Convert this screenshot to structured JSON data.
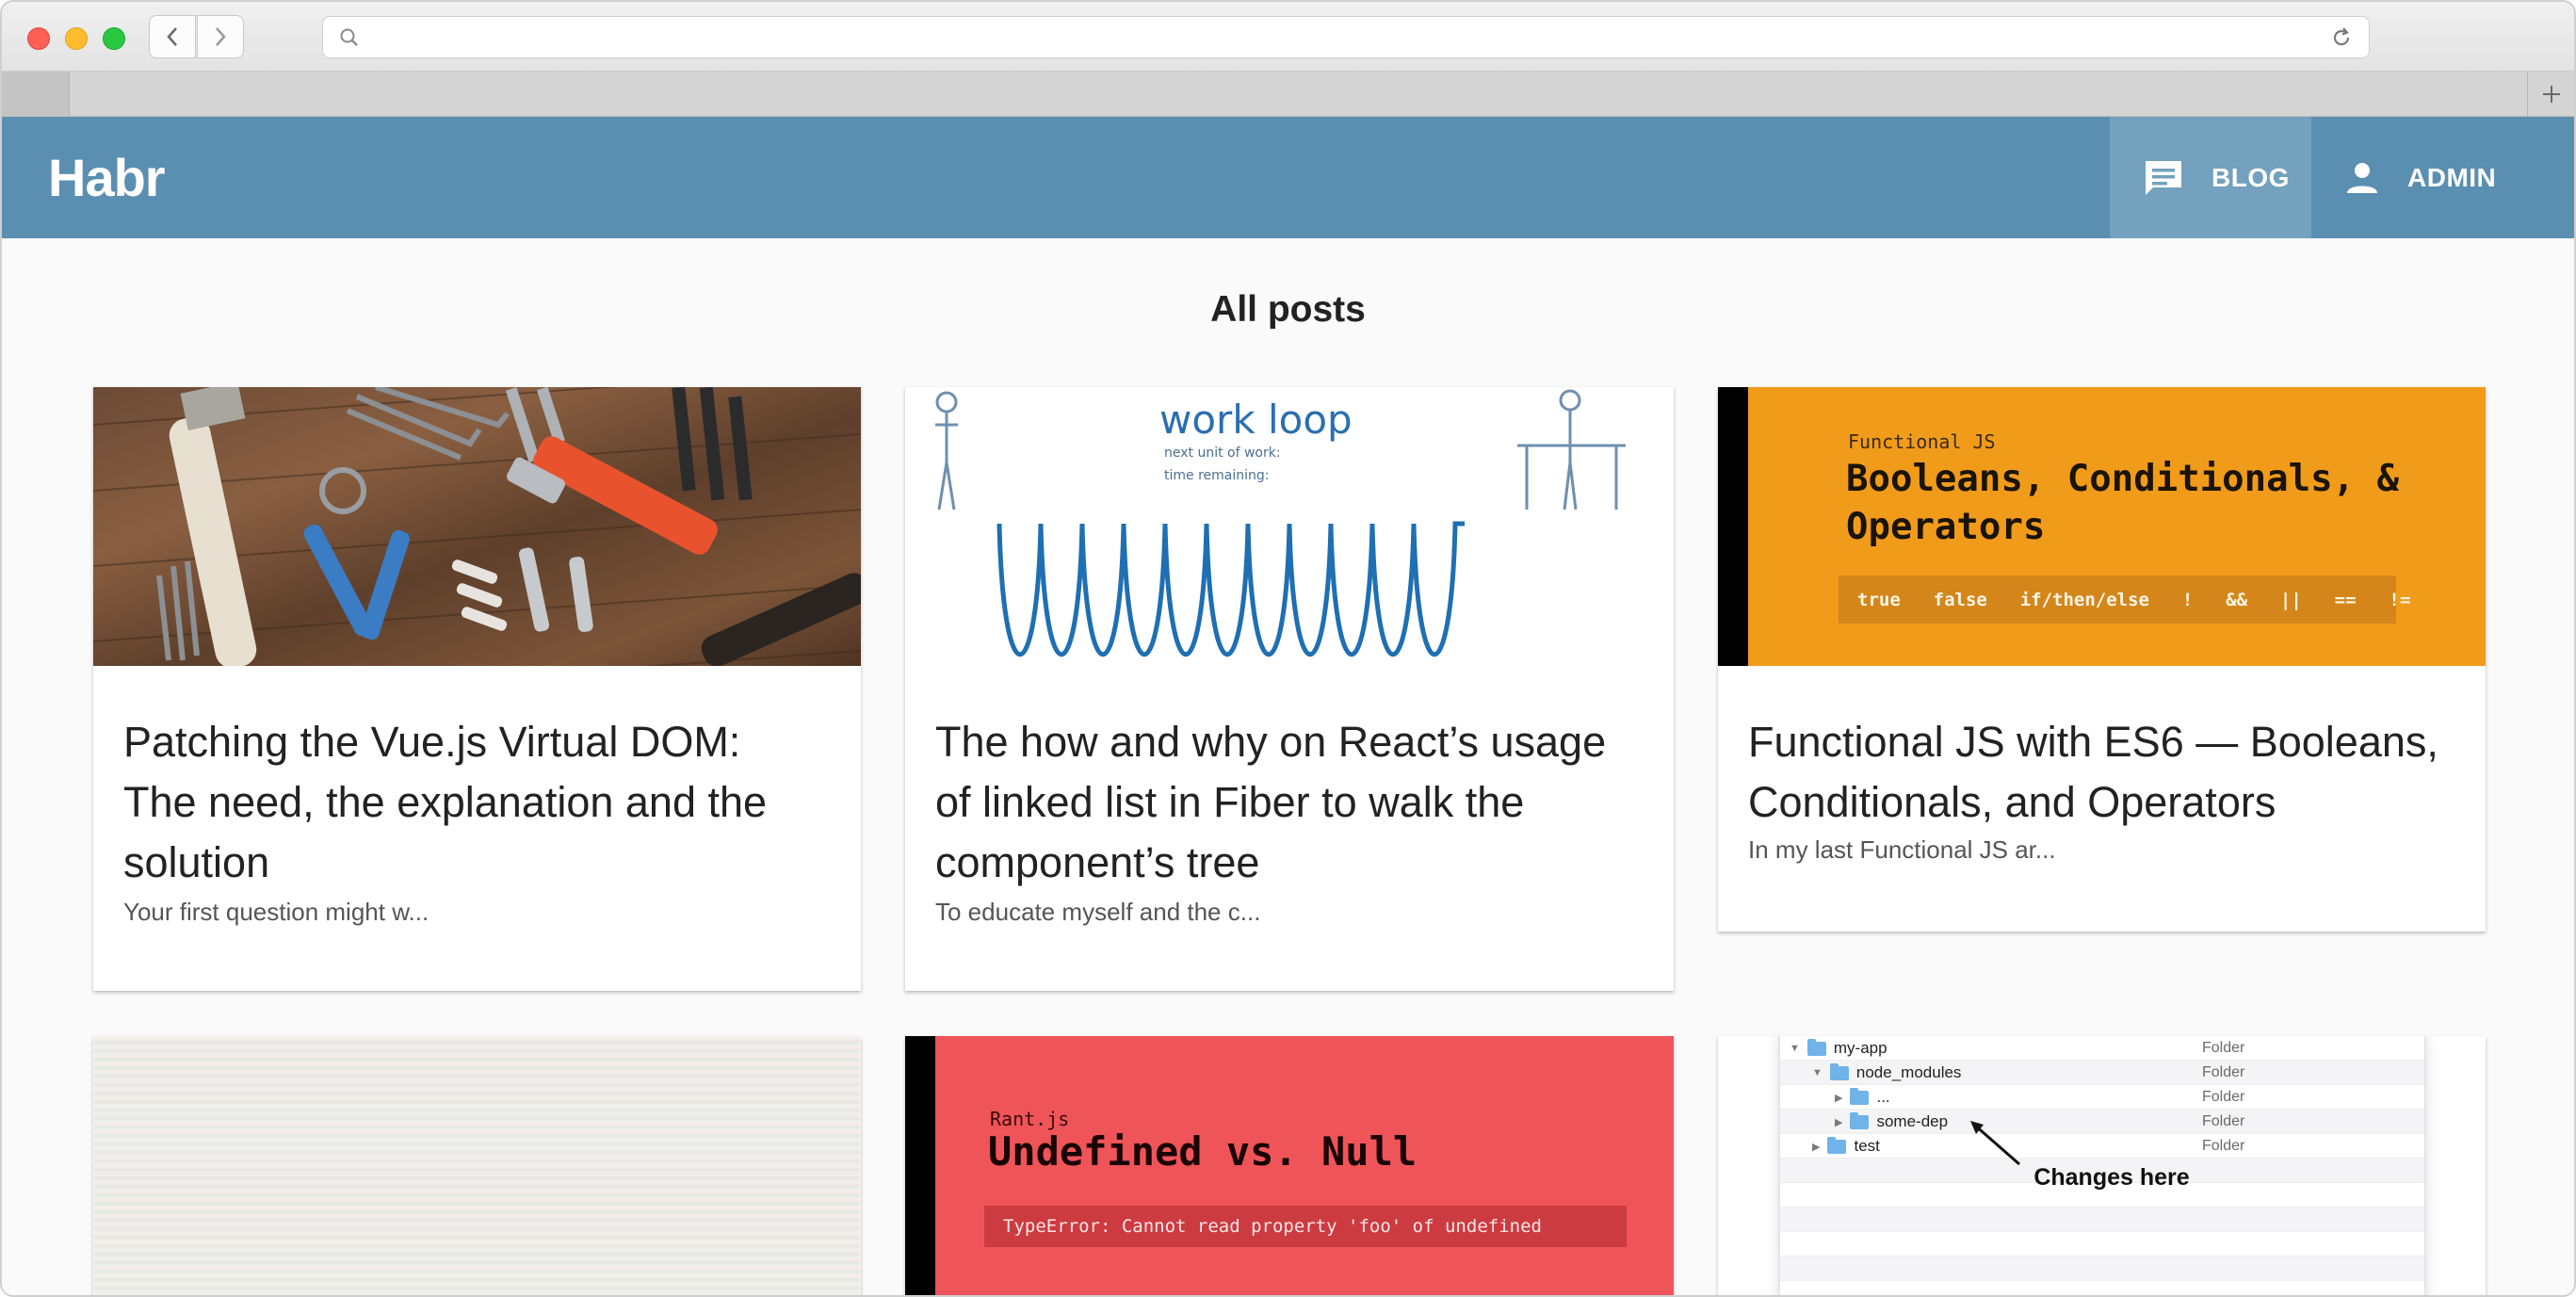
{
  "app": {
    "brand": "Habr"
  },
  "nav": {
    "blog_label": "BLOG",
    "admin_label": "ADMIN"
  },
  "page": {
    "title": "All posts"
  },
  "posts": [
    {
      "title": "Patching the Vue.js Virtual DOM: The need, the explanation and the solution",
      "excerpt": "Your first question might w...",
      "image": "tools-on-wooden-table"
    },
    {
      "title": "The how and why on React’s usage of linked list in Fiber to walk the component’s tree",
      "excerpt": "To educate myself and the c...",
      "image": "work-loop-illustration",
      "image_text": {
        "title": "work loop",
        "line1": "next unit of work:",
        "line2": "time remaining:"
      }
    },
    {
      "title": "Functional JS with ES6 — Booleans, Conditionals, and Operators",
      "excerpt": "In my last Functional JS ar...",
      "image": "functional-js-banner",
      "image_text": {
        "small": "Functional JS",
        "big": "Booleans, Conditionals, & Operators",
        "code": "true  false  if/then/else  !  &&  ||  ==  !="
      }
    },
    {
      "title": "",
      "excerpt": "",
      "image": "blurred-code-screen"
    },
    {
      "title": "",
      "excerpt": "",
      "image": "rant-js-banner",
      "image_text": {
        "small": "Rant.js",
        "big": "Undefined vs. Null",
        "code": "TypeError: Cannot read property 'foo' of undefined"
      }
    },
    {
      "title": "",
      "excerpt": "",
      "image": "finder-tree-screenshot",
      "image_text": {
        "rows": [
          {
            "name": "my-app",
            "kind": "Folder"
          },
          {
            "name": "node_modules",
            "kind": "Folder"
          },
          {
            "name": "...",
            "kind": "Folder"
          },
          {
            "name": "some-dep",
            "kind": "Folder"
          },
          {
            "name": "test",
            "kind": "Folder"
          }
        ],
        "callout": "Changes here"
      }
    }
  ],
  "icons": {
    "blog": "chat-bubble-icon",
    "admin": "person-icon",
    "search": "search-icon",
    "reload": "reload-icon",
    "back": "chevron-left-icon",
    "forward": "chevron-right-icon",
    "new_tab": "plus-icon"
  },
  "colors": {
    "appbar": "#5a8fb1",
    "appbar_active": "#73a1be",
    "fjs_orange": "#f19b1a",
    "rant_red": "#ef5459"
  }
}
